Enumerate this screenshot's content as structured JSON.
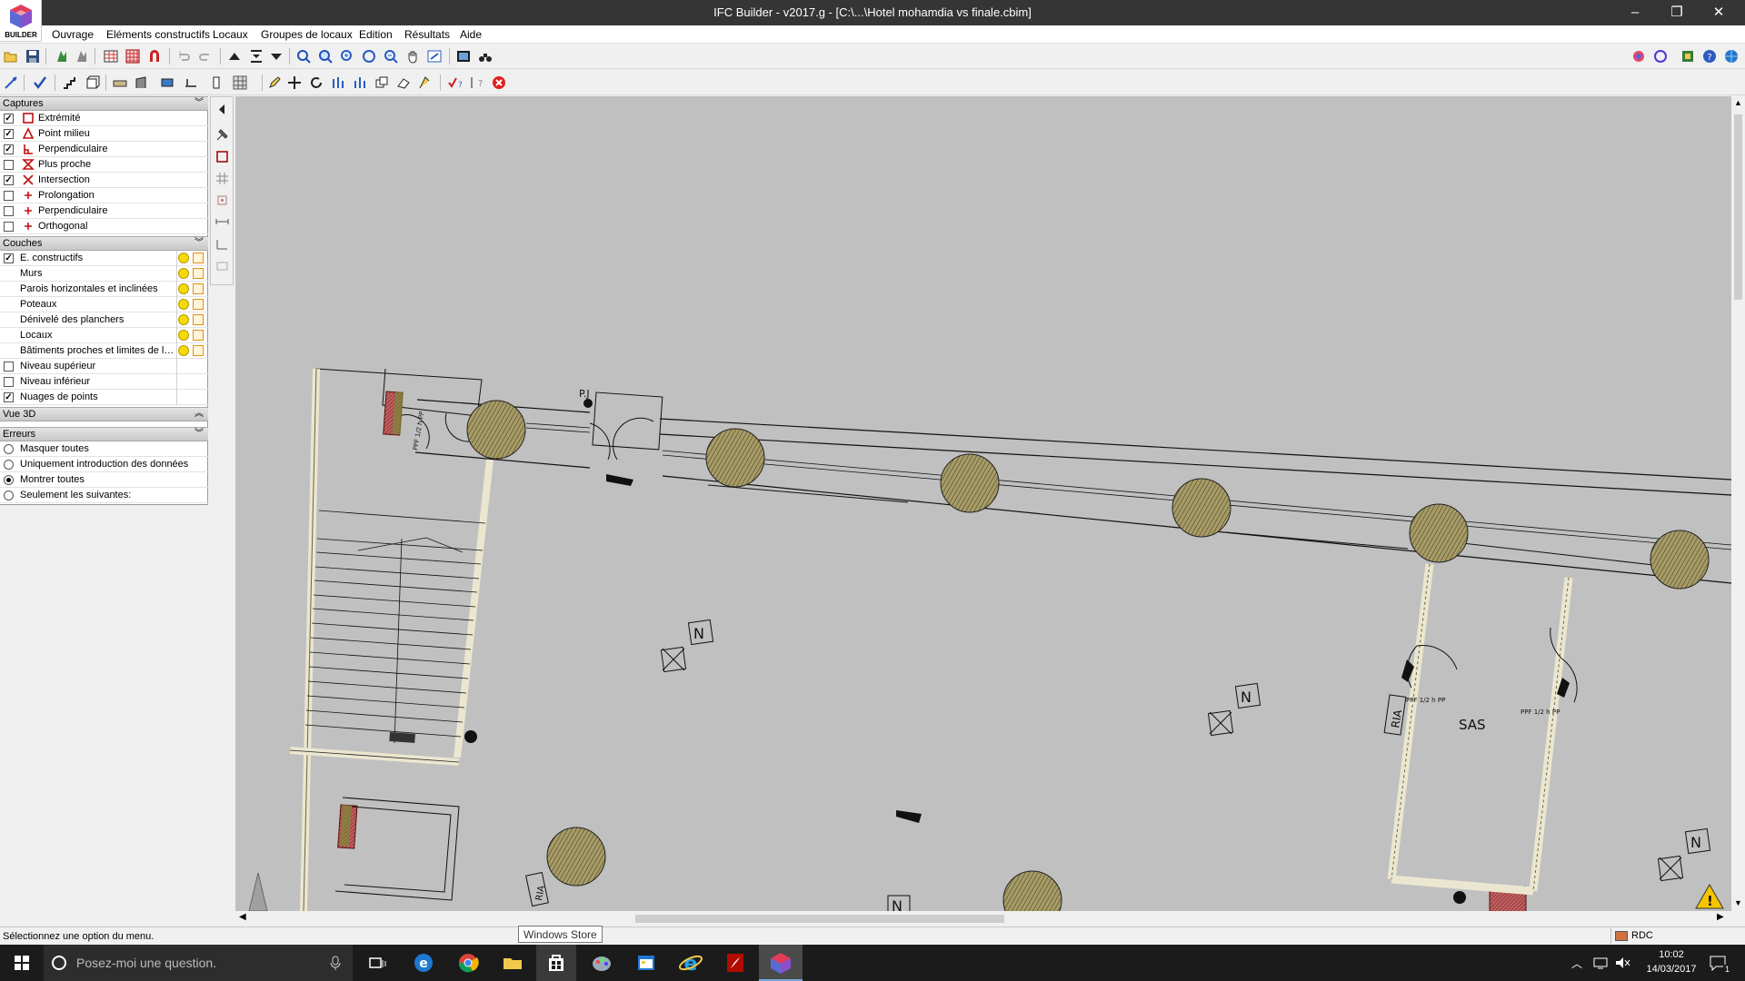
{
  "window": {
    "title": "IFC Builder - v2017.g - [C:\\...\\Hotel mohamdia vs finale.cbim]",
    "logo_text": "BUILDER",
    "controls": [
      "–",
      "❐",
      "✕"
    ]
  },
  "menu": [
    "Ouvrage",
    "Eléments constructifs",
    "Locaux",
    "Groupes de locaux",
    "Edition",
    "Résultats",
    "Aide"
  ],
  "panels": {
    "captures": {
      "title": "Captures",
      "items": [
        {
          "label": "Extrémité",
          "checked": true,
          "symbol": "square"
        },
        {
          "label": "Point milieu",
          "checked": true,
          "symbol": "triangle"
        },
        {
          "label": "Perpendiculaire",
          "checked": true,
          "symbol": "perp"
        },
        {
          "label": "Plus proche",
          "checked": false,
          "symbol": "hourglass"
        },
        {
          "label": "Intersection",
          "checked": true,
          "symbol": "cross"
        },
        {
          "label": "Prolongation",
          "checked": false,
          "symbol": "plus"
        },
        {
          "label": "Perpendiculaire",
          "checked": false,
          "symbol": "plus"
        },
        {
          "label": "Orthogonal",
          "checked": false,
          "symbol": "plus"
        }
      ]
    },
    "couches": {
      "title": "Couches",
      "items": [
        {
          "label": "E. constructifs",
          "checked": true,
          "icons": true
        },
        {
          "label": "Murs",
          "checked": null,
          "icons": true
        },
        {
          "label": "Parois horizontales et inclinées",
          "checked": null,
          "icons": true
        },
        {
          "label": "Poteaux",
          "checked": null,
          "icons": true
        },
        {
          "label": "Dénivelé des planchers",
          "checked": null,
          "icons": true
        },
        {
          "label": "Locaux",
          "checked": null,
          "icons": true
        },
        {
          "label": "Bâtiments proches et limites de la ...",
          "checked": null,
          "icons": true
        },
        {
          "label": "Niveau supérieur",
          "checked": false,
          "icons": false
        },
        {
          "label": "Niveau inférieur",
          "checked": false,
          "icons": false
        },
        {
          "label": "Nuages de points",
          "checked": true,
          "icons": false
        }
      ]
    },
    "vue3d": {
      "title": "Vue 3D"
    },
    "erreurs": {
      "title": "Erreurs",
      "options": [
        {
          "label": "Masquer toutes",
          "selected": false
        },
        {
          "label": "Uniquement introduction des données",
          "selected": false
        },
        {
          "label": "Montrer toutes",
          "selected": true
        },
        {
          "label": "Seulement les suivantes:",
          "selected": false
        }
      ]
    }
  },
  "drawing": {
    "labels": {
      "pj": "P.J",
      "door1": "PPF 1/2 h PP",
      "door2": "PPF 1/2 h PP",
      "door3": "PPF 1/2 h PP",
      "sas": "SAS",
      "ria1": "RIA",
      "ria2": "RIA",
      "n_mark": "N"
    }
  },
  "status": {
    "message": "Sélectionnez une option du menu.",
    "level": "RDC"
  },
  "tooltip": "Windows Store",
  "taskbar": {
    "search_placeholder": "Posez-moi une question.",
    "time": "10:02",
    "date": "14/03/2017",
    "notifications": "1"
  },
  "colors": {
    "title_bg": "#353535",
    "canvas_bg": "#c0c0c0",
    "column_fill": "#a79c66",
    "wall_fill": "#ebe6cf",
    "fire_element": "#8b1a1a",
    "taskbar_bg": "#1b1b1b"
  }
}
